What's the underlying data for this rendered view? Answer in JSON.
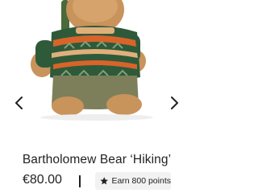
{
  "product": {
    "title": "Bartholomew Bear ‘Hiking’",
    "price": "€80.00",
    "points_label": "Earn 800 points"
  },
  "gallery": {
    "image_icon": "teddy-bear-in-hiking-sweater",
    "prev_icon": "chevron-left-icon",
    "next_icon": "chevron-right-icon"
  },
  "colors": {
    "text": "#222222",
    "badge_bg": "#f2f2f2",
    "bear_fur": "#c9935c",
    "sweater_green": "#2e5a3a",
    "sweater_orange": "#d8642a",
    "trousers": "#7d7f5a"
  }
}
